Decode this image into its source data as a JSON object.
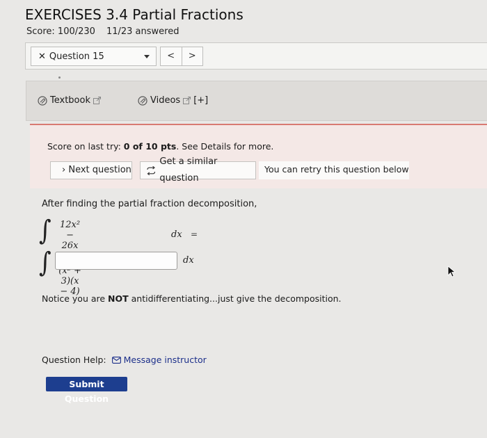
{
  "header": {
    "title": "EXERCISES 3.4 Partial Fractions",
    "score": "Score: 100/230",
    "answered": "11/23 answered"
  },
  "question_nav": {
    "selected": "Question 15",
    "prev": "<",
    "next": ">"
  },
  "resources": {
    "textbook": "Textbook",
    "videos": "Videos",
    "videos_more": "[+]"
  },
  "last_try": {
    "prefix": "Score on last try: ",
    "score": "0 of 10 pts",
    "suffix": ". See Details for more.",
    "next_button": "Next question",
    "similar_button": "Get a similar question",
    "retry_note": "You can retry this question below"
  },
  "question": {
    "prompt": "After finding the partial fraction decomposition,",
    "numerator": "12x² − 26x + 7",
    "denominator": "(x² + 3)(x − 4)",
    "dx": "dx",
    "equals": "=",
    "answer_value": "",
    "answer_dx": "dx",
    "notice_prefix": "Notice you are ",
    "notice_bold": "NOT",
    "notice_suffix": " antidifferentiating...just give the decomposition."
  },
  "help": {
    "label": "Question Help:",
    "message": "Message instructor"
  },
  "submit": "Submit Question"
}
